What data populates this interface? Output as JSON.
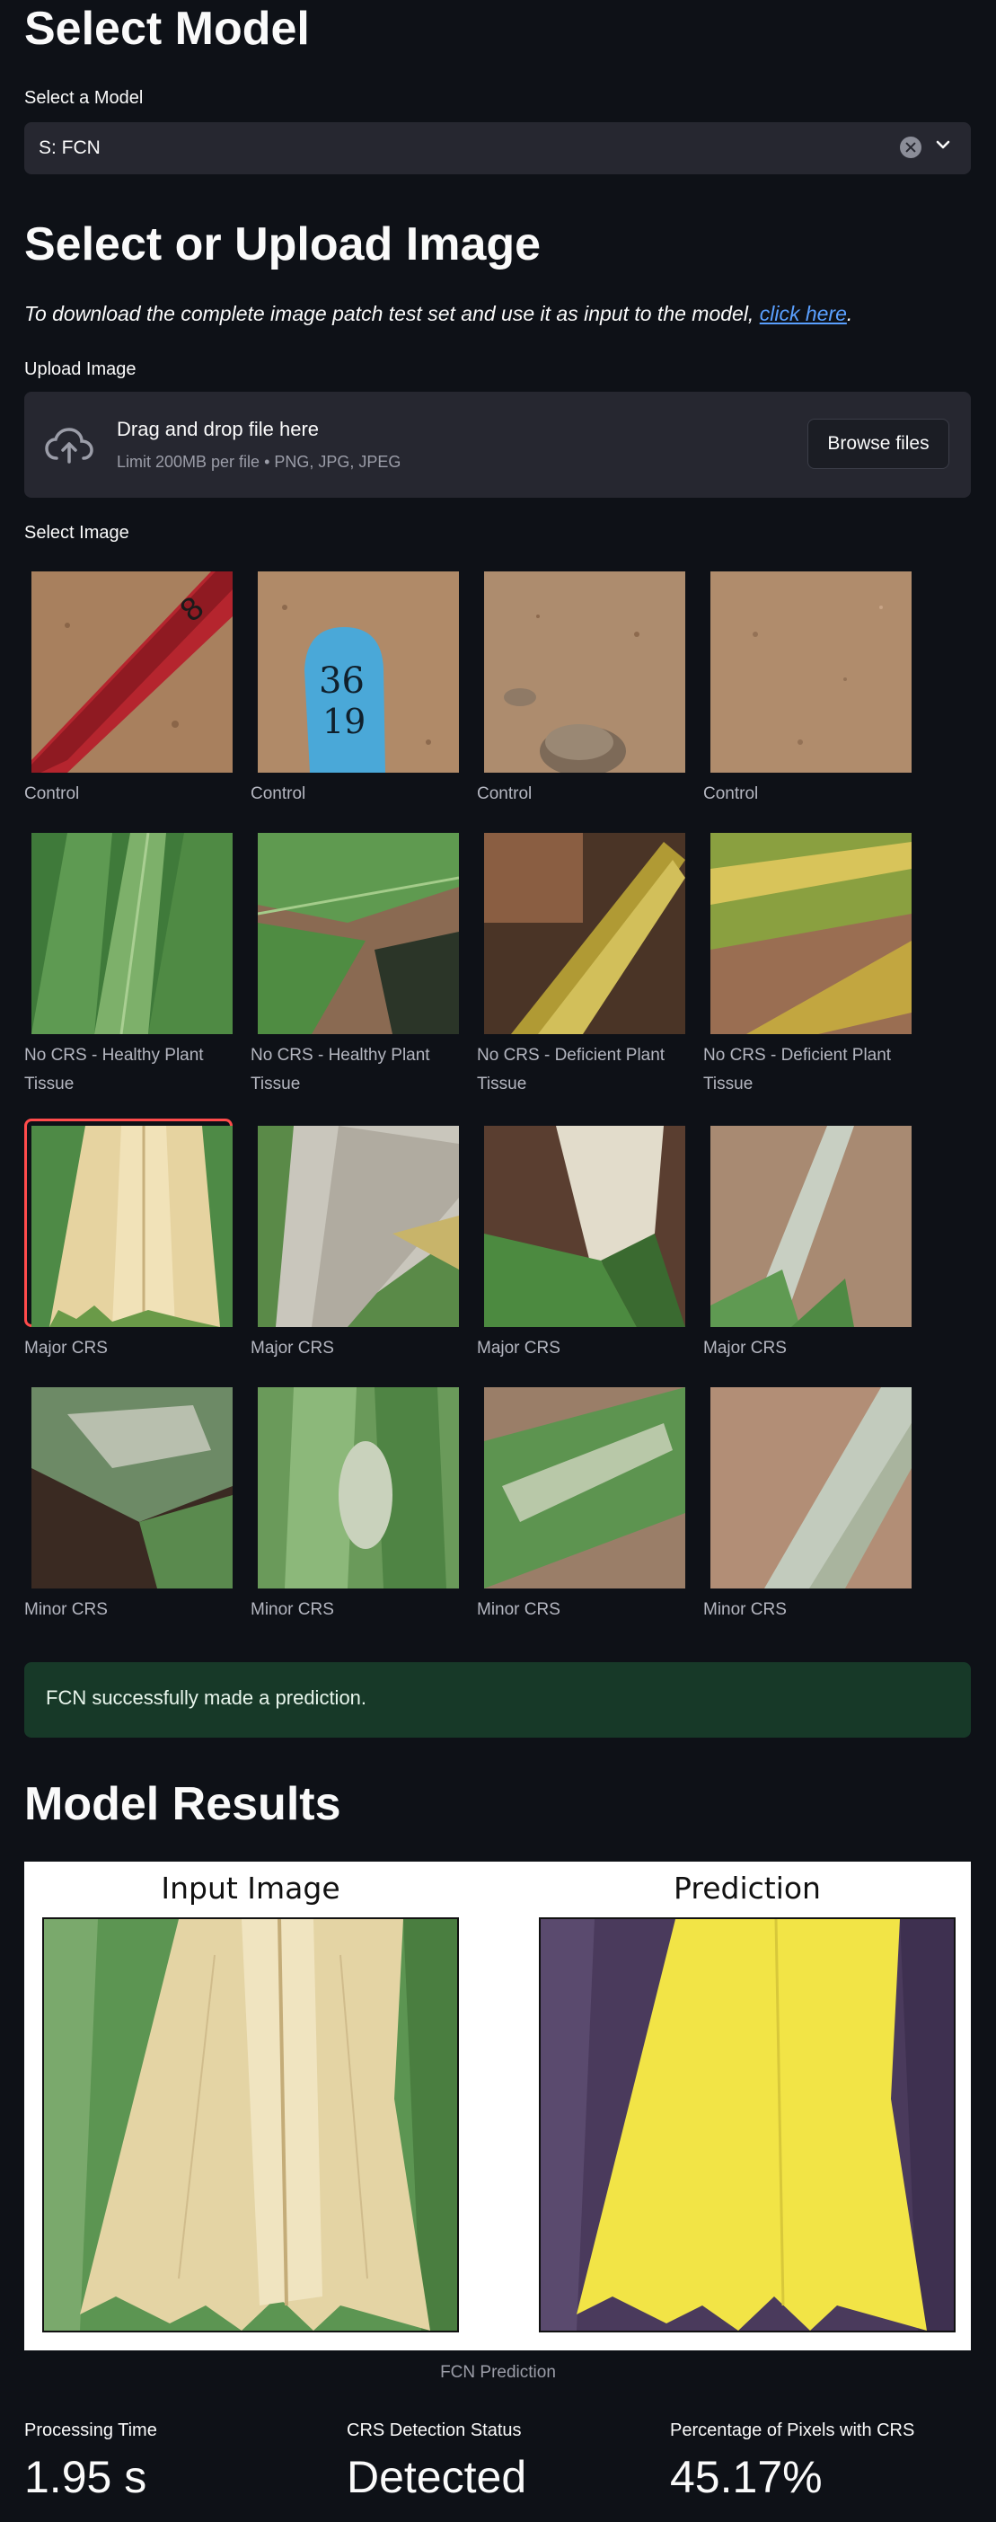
{
  "model_section": {
    "heading": "Select Model",
    "select_label": "Select a Model",
    "selected_model": "S: FCN"
  },
  "image_section": {
    "heading": "Select or Upload Image",
    "intro_text": "To download the complete image patch test set and use it as input to the model, ",
    "intro_link": "click here",
    "intro_end": ".",
    "upload_label": "Upload Image",
    "dropzone_title": "Drag and drop file here",
    "dropzone_limits": "Limit 200MB per file • PNG, JPG, JPEG",
    "browse_label": "Browse files",
    "select_image_label": "Select Image",
    "gallery": [
      {
        "caption": "Control",
        "kind": "soil-stake-red"
      },
      {
        "caption": "Control",
        "kind": "soil-tag-blue",
        "tag_text_1": "36",
        "tag_text_2": "19"
      },
      {
        "caption": "Control",
        "kind": "soil-rocks"
      },
      {
        "caption": "Control",
        "kind": "soil-plain"
      },
      {
        "caption": "No CRS - Healthy Plant Tissue",
        "kind": "leaf-healthy-close"
      },
      {
        "caption": "No CRS - Healthy Plant Tissue",
        "kind": "leaf-healthy-shadow"
      },
      {
        "caption": "No CRS - Deficient Plant Tissue",
        "kind": "leaf-deficient-dark"
      },
      {
        "caption": "No CRS - Deficient Plant Tissue",
        "kind": "leaf-deficient-stripes"
      },
      {
        "caption": "Major CRS",
        "kind": "leaf-major-1",
        "selected": true
      },
      {
        "caption": "Major CRS",
        "kind": "leaf-major-2"
      },
      {
        "caption": "Major CRS",
        "kind": "leaf-major-3"
      },
      {
        "caption": "Major CRS",
        "kind": "leaf-major-4"
      },
      {
        "caption": "Minor CRS",
        "kind": "leaf-minor-1"
      },
      {
        "caption": "Minor CRS",
        "kind": "leaf-minor-2"
      },
      {
        "caption": "Minor CRS",
        "kind": "leaf-minor-3"
      },
      {
        "caption": "Minor CRS",
        "kind": "leaf-minor-4"
      }
    ]
  },
  "status": {
    "success_message": "FCN successfully made a prediction."
  },
  "results": {
    "heading": "Model Results",
    "input_title": "Input Image",
    "prediction_title": "Prediction",
    "figure_caption": "FCN Prediction",
    "metrics": [
      {
        "label": "Processing Time",
        "value": "1.95 s"
      },
      {
        "label": "CRS Detection Status",
        "value": "Detected"
      },
      {
        "label": "Percentage of Pixels with CRS",
        "value": "45.17%"
      }
    ],
    "crs_pixel_fraction": 0.4517
  },
  "colors": {
    "background": "#0e1117",
    "widget": "#262730",
    "accent_selected": "#ff4b4b",
    "success_bg": "#173928",
    "link": "#5aa0ff",
    "mask_crs": "#f2e446",
    "mask_background": "#4a3a5c"
  }
}
